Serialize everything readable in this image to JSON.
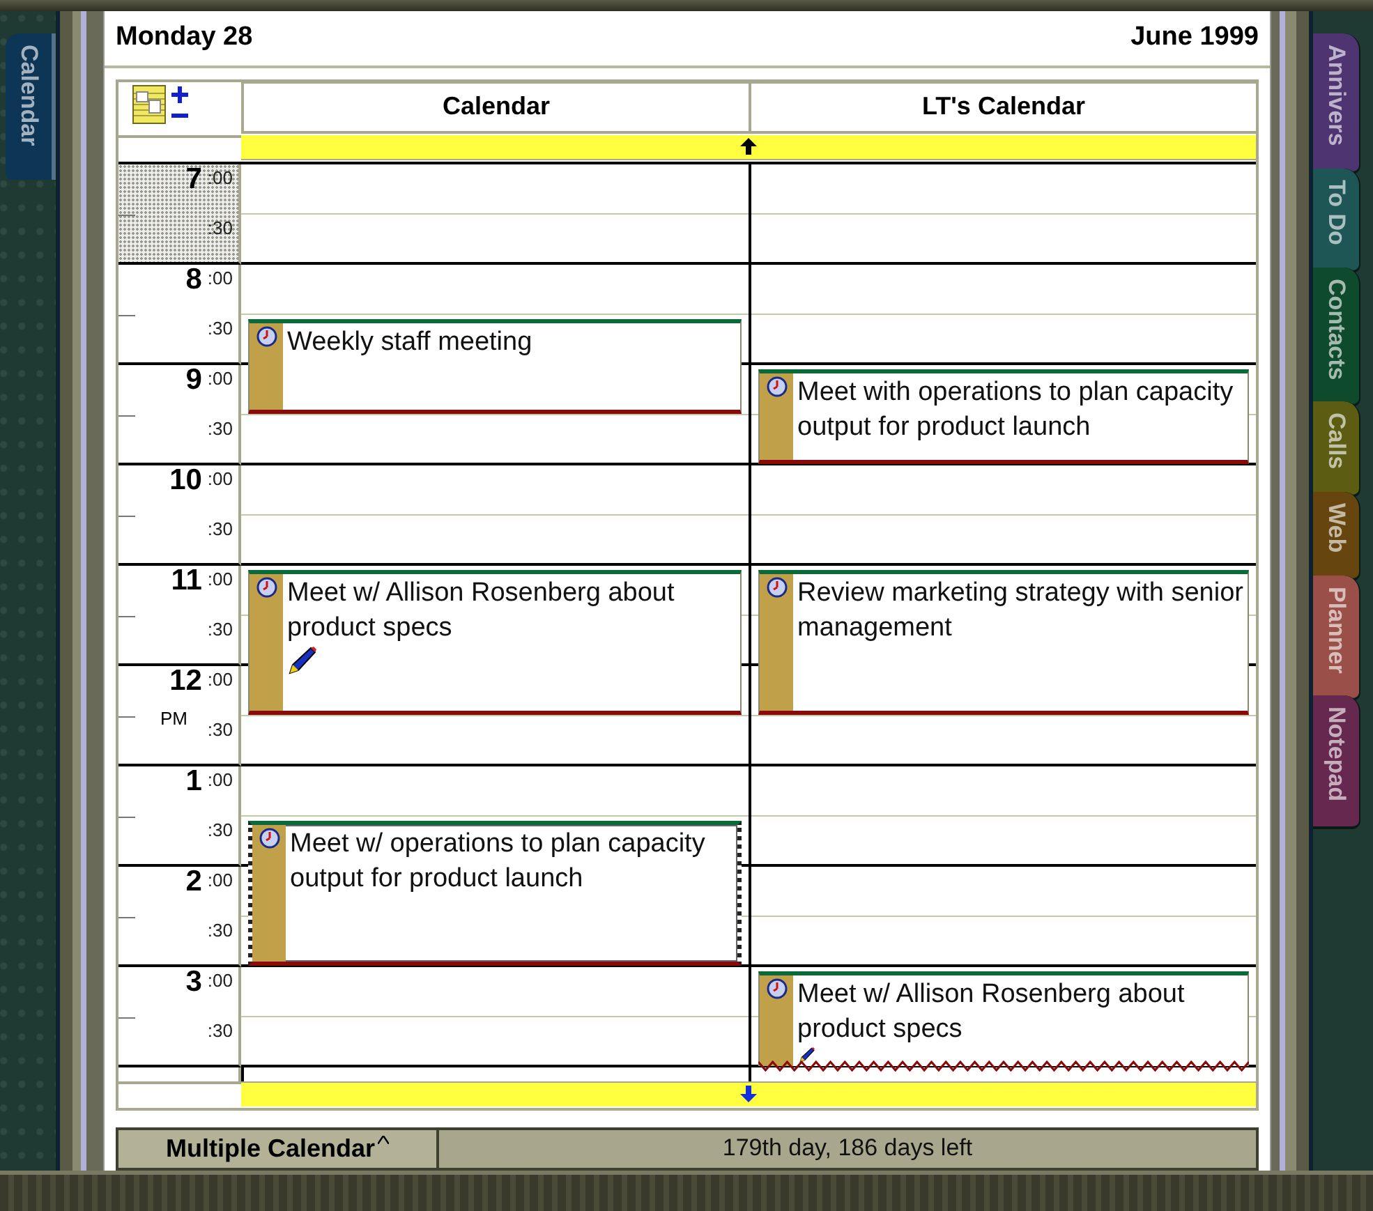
{
  "header": {
    "day": "Monday 28",
    "month": "June 1999"
  },
  "left_tabs": [
    {
      "label": "Calendar",
      "color": "#0d3556",
      "selected": true
    }
  ],
  "right_tabs": [
    {
      "label": "Annivers",
      "color": "#4e3470",
      "selected": false
    },
    {
      "label": "To Do",
      "color": "#1e5656",
      "selected": false
    },
    {
      "label": "Contacts",
      "color": "#0e4a2c",
      "selected": false
    },
    {
      "label": "Calls",
      "color": "#5c5c12",
      "selected": false
    },
    {
      "label": "Web",
      "color": "#66460e",
      "selected": false
    },
    {
      "label": "Planner",
      "color": "#9a5048",
      "selected": false
    },
    {
      "label": "Notepad",
      "color": "#66284e",
      "selected": false
    }
  ],
  "time_slots": [
    {
      "hour": "7",
      "minutes": ":00",
      "shaded": true
    },
    {
      "minutes": ":30",
      "shaded": true
    },
    {
      "hour": "8",
      "minutes": ":00",
      "shaded": false
    },
    {
      "minutes": ":30",
      "shaded": false
    },
    {
      "hour": "9",
      "minutes": ":00",
      "shaded": false
    },
    {
      "minutes": ":30",
      "shaded": false
    },
    {
      "hour": "10",
      "minutes": ":00",
      "shaded": false
    },
    {
      "minutes": ":30",
      "shaded": false
    },
    {
      "hour": "11",
      "minutes": ":00",
      "shaded": false
    },
    {
      "minutes": ":30",
      "shaded": false
    },
    {
      "hour": "12",
      "minutes": ":00",
      "shaded": false
    },
    {
      "meridiem": "PM",
      "minutes": ":30",
      "shaded": false
    },
    {
      "hour": "1",
      "minutes": ":00",
      "shaded": false
    },
    {
      "minutes": ":30",
      "shaded": false
    },
    {
      "hour": "2",
      "minutes": ":00",
      "shaded": false
    },
    {
      "minutes": ":30",
      "shaded": false
    },
    {
      "hour": "3",
      "minutes": ":00",
      "shaded": false
    },
    {
      "minutes": ":30",
      "shaded": false
    }
  ],
  "columns": [
    {
      "title": "Calendar",
      "rows": [
        {
          "kind": "free"
        },
        {
          "kind": "free"
        },
        {
          "kind": "free"
        },
        {
          "kind": "event",
          "title": "Weekly staff meeting",
          "selected": false,
          "has_note": false,
          "continues": false
        },
        {
          "kind": "busy"
        },
        {
          "kind": "free"
        },
        {
          "kind": "free"
        },
        {
          "kind": "free"
        },
        {
          "kind": "event",
          "title": "Meet w/ Allison Rosenberg about product specs",
          "selected": false,
          "has_note": true,
          "continues": false
        },
        {
          "kind": "busy"
        },
        {
          "kind": "busy"
        },
        {
          "kind": "free"
        },
        {
          "kind": "free"
        },
        {
          "kind": "event",
          "title": "Meet w/ operations to plan capacity output for product launch",
          "selected": true,
          "has_note": false,
          "continues": false
        },
        {
          "kind": "busy"
        },
        {
          "kind": "busy"
        },
        {
          "kind": "free"
        },
        {
          "kind": "free"
        }
      ]
    },
    {
      "title": "LT's Calendar",
      "rows": [
        {
          "kind": "free"
        },
        {
          "kind": "free"
        },
        {
          "kind": "free"
        },
        {
          "kind": "free"
        },
        {
          "kind": "event",
          "title": "Meet with operations to plan capacity output for product launch",
          "selected": false,
          "has_note": false,
          "continues": false
        },
        {
          "kind": "busy"
        },
        {
          "kind": "free"
        },
        {
          "kind": "free"
        },
        {
          "kind": "event",
          "title": "Review marketing strategy with senior management",
          "selected": false,
          "has_note": false,
          "continues": false
        },
        {
          "kind": "busy"
        },
        {
          "kind": "busy"
        },
        {
          "kind": "free"
        },
        {
          "kind": "free"
        },
        {
          "kind": "free"
        },
        {
          "kind": "free"
        },
        {
          "kind": "free"
        },
        {
          "kind": "event",
          "title": "Meet w/ Allison Rosenberg about product specs",
          "selected": false,
          "has_note": true,
          "continues": true
        },
        {
          "kind": "busy"
        }
      ]
    }
  ],
  "status_bar": {
    "view_button": "Multiple Calendar",
    "info": "179th day, 186 days left"
  }
}
